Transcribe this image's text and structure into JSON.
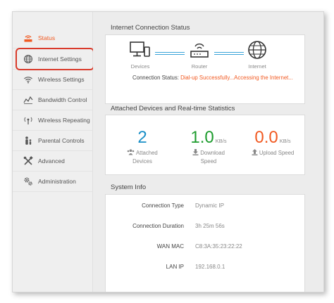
{
  "sidebar": {
    "items": [
      {
        "label": "Status",
        "icon": "router-icon"
      },
      {
        "label": "Internet Settings",
        "icon": "globe-icon"
      },
      {
        "label": "Wireless Settings",
        "icon": "wifi-icon"
      },
      {
        "label": "Bandwidth Control",
        "icon": "bandwidth-icon"
      },
      {
        "label": "Wireless Repeating",
        "icon": "antenna-icon"
      },
      {
        "label": "Parental Controls",
        "icon": "parent-child-icon"
      },
      {
        "label": "Advanced",
        "icon": "tools-icon"
      },
      {
        "label": "Administration",
        "icon": "gears-icon"
      }
    ]
  },
  "internet_status": {
    "title": "Internet Connection Status",
    "devices_label": "Devices",
    "router_label": "Router",
    "internet_label": "Internet",
    "status_prefix": "Connection Status:",
    "status_value": "Dial-up Successfully...Accessing the Internet..."
  },
  "stats": {
    "title": "Attached Devices and Real-time Statistics",
    "attached": {
      "value": "2",
      "label_line1": "Attached",
      "label_line2": "Devices"
    },
    "download": {
      "value": "1.0",
      "unit": "KB/s",
      "label_line1": "Download",
      "label_line2": "Speed"
    },
    "upload": {
      "value": "0.0",
      "unit": "KB/s",
      "label_line1": "Upload Speed"
    }
  },
  "system_info": {
    "title": "System Info",
    "rows": [
      {
        "key": "Connection Type",
        "value": "Dynamic IP"
      },
      {
        "key": "Connection Duration",
        "value": "3h 25m 56s"
      },
      {
        "key": "WAN MAC",
        "value": "C8:3A:35:23:22:22"
      },
      {
        "key": "LAN IP",
        "value": "192.168.0.1"
      }
    ]
  },
  "colors": {
    "accent": "#f15a22",
    "blue": "#1a8fc7",
    "green": "#1e9c2e",
    "highlight": "#d93a2b",
    "link": "#39a4d9"
  }
}
